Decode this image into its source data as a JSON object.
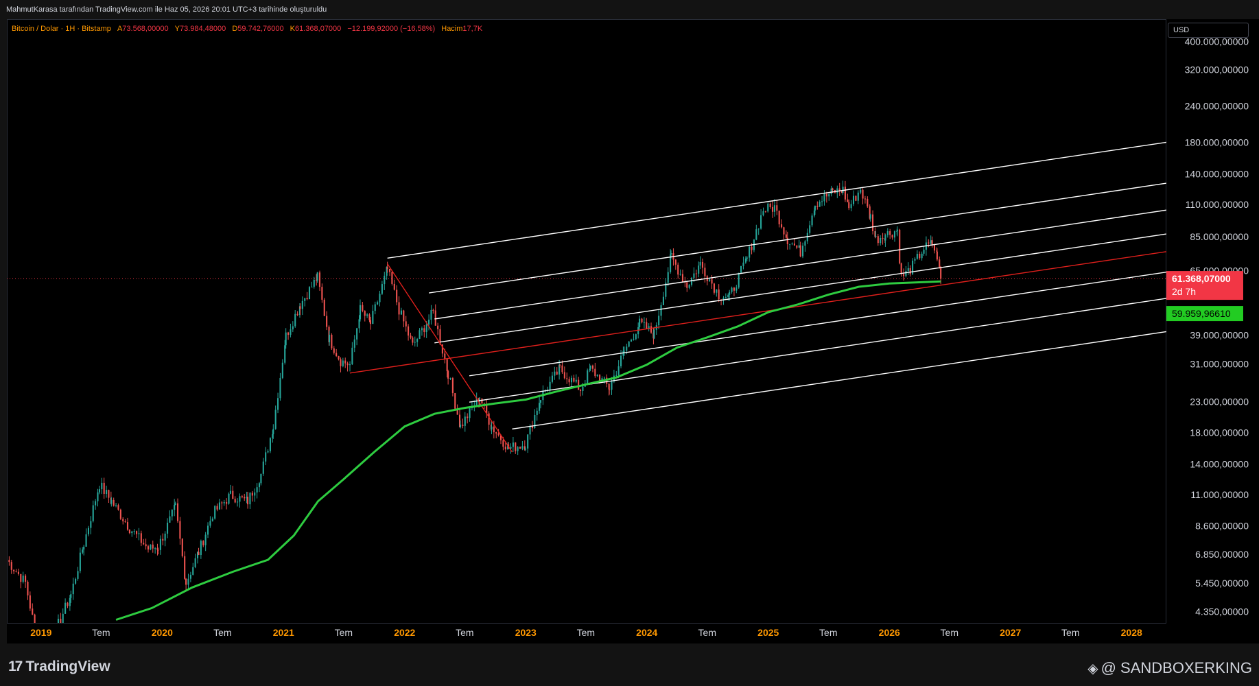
{
  "header": {
    "caption": "MahmutKarasa tarafından TradingView.com ile Haz 05, 2026 20:01 UTC+3 tarihinde oluşturuldu"
  },
  "legend": {
    "symbol": "Bitcoin / Dolar · 1H · Bitstamp",
    "open_label": "A",
    "open_value": "73.568,00000",
    "high_label": "Y",
    "high_value": "73.984,48000",
    "low_label": "D",
    "low_value": "59.742,76000",
    "close_label": "K",
    "close_value": "61.368,07000",
    "change_value": "−12.199,92000 (−16,58%)",
    "volume_label": "Hacim",
    "volume_value": "17,7K"
  },
  "currency": "USD",
  "price_tags": {
    "last_price": "61.368,07000",
    "countdown": "2d 7h",
    "ma_value": "59.959,96610"
  },
  "footer": {
    "logo_text": "TradingView",
    "watermark": "@ SANDBOXERKING"
  },
  "colors": {
    "background": "#000000",
    "up": "#26a69a",
    "down": "#ef5350",
    "ma": "#2ecc40",
    "channel": "#ffffff",
    "median": "#e0201c",
    "axis_text": "#d1d4dc",
    "year_text": "#ff9800"
  },
  "chart_data": {
    "type": "candlestick",
    "symbol": "Bitcoin / Dolar",
    "scale": "log",
    "y_ticks": [
      "400.000,00000",
      "320.000,00000",
      "240.000,00000",
      "180.000,00000",
      "140.000,00000",
      "110.000,00000",
      "85.000,00000",
      "65.000,00000",
      "39.000,00000",
      "31.000,00000",
      "23.000,00000",
      "18.000,00000",
      "14.000,00000",
      "11.000,00000",
      "8.600,00000",
      "6.850,00000",
      "5.450,00000",
      "4.350,00000"
    ],
    "y_tick_values": [
      400000,
      320000,
      240000,
      180000,
      140000,
      110000,
      85000,
      65000,
      39000,
      31000,
      23000,
      18000,
      14000,
      11000,
      8600,
      6850,
      5450,
      4350
    ],
    "x_ticks": [
      {
        "label": "2019",
        "date": "2019-01-01",
        "year": true
      },
      {
        "label": "Tem",
        "date": "2019-07-01",
        "year": false
      },
      {
        "label": "2020",
        "date": "2020-01-01",
        "year": true
      },
      {
        "label": "Tem",
        "date": "2020-07-01",
        "year": false
      },
      {
        "label": "2021",
        "date": "2021-01-01",
        "year": true
      },
      {
        "label": "Tem",
        "date": "2021-07-01",
        "year": false
      },
      {
        "label": "2022",
        "date": "2022-01-01",
        "year": true
      },
      {
        "label": "Tem",
        "date": "2022-07-01",
        "year": false
      },
      {
        "label": "2023",
        "date": "2023-01-01",
        "year": true
      },
      {
        "label": "Tem",
        "date": "2023-07-01",
        "year": false
      },
      {
        "label": "2024",
        "date": "2024-01-01",
        "year": true
      },
      {
        "label": "Tem",
        "date": "2024-07-01",
        "year": false
      },
      {
        "label": "2025",
        "date": "2025-01-01",
        "year": true
      },
      {
        "label": "Tem",
        "date": "2025-07-01",
        "year": false
      },
      {
        "label": "2026",
        "date": "2026-01-01",
        "year": true
      },
      {
        "label": "Tem",
        "date": "2026-07-01",
        "year": false
      },
      {
        "label": "2027",
        "date": "2027-01-01",
        "year": true
      },
      {
        "label": "Tem",
        "date": "2027-07-01",
        "year": false
      },
      {
        "label": "2028",
        "date": "2028-01-01",
        "year": true
      }
    ],
    "x_range": [
      "2018-09-20",
      "2028-04-15"
    ],
    "y_range": [
      4000,
      480000
    ],
    "close_series": [
      {
        "date": "2018-09-20",
        "close": 6600
      },
      {
        "date": "2018-11-15",
        "close": 5500
      },
      {
        "date": "2018-12-15",
        "close": 3700
      },
      {
        "date": "2019-02-15",
        "close": 3800
      },
      {
        "date": "2019-04-01",
        "close": 5000
      },
      {
        "date": "2019-05-10",
        "close": 7500
      },
      {
        "date": "2019-06-26",
        "close": 12000
      },
      {
        "date": "2019-08-01",
        "close": 10500
      },
      {
        "date": "2019-09-25",
        "close": 8500
      },
      {
        "date": "2019-11-20",
        "close": 7200
      },
      {
        "date": "2019-12-20",
        "close": 7300
      },
      {
        "date": "2020-02-10",
        "close": 10000
      },
      {
        "date": "2020-03-13",
        "close": 5500
      },
      {
        "date": "2020-04-20",
        "close": 7000
      },
      {
        "date": "2020-06-01",
        "close": 9500
      },
      {
        "date": "2020-07-25",
        "close": 11000
      },
      {
        "date": "2020-09-15",
        "close": 10500
      },
      {
        "date": "2020-10-25",
        "close": 13000
      },
      {
        "date": "2020-12-01",
        "close": 19000
      },
      {
        "date": "2021-01-08",
        "close": 39000
      },
      {
        "date": "2021-02-20",
        "close": 50000
      },
      {
        "date": "2021-04-13",
        "close": 62000
      },
      {
        "date": "2021-05-19",
        "close": 38000
      },
      {
        "date": "2021-06-22",
        "close": 32000
      },
      {
        "date": "2021-07-20",
        "close": 31000
      },
      {
        "date": "2021-08-20",
        "close": 48000
      },
      {
        "date": "2021-09-20",
        "close": 43000
      },
      {
        "date": "2021-11-10",
        "close": 66000
      },
      {
        "date": "2021-12-15",
        "close": 48000
      },
      {
        "date": "2022-01-25",
        "close": 36000
      },
      {
        "date": "2022-03-28",
        "close": 47000
      },
      {
        "date": "2022-05-12",
        "close": 29000
      },
      {
        "date": "2022-06-18",
        "close": 19000
      },
      {
        "date": "2022-08-15",
        "close": 24000
      },
      {
        "date": "2022-09-20",
        "close": 19000
      },
      {
        "date": "2022-11-10",
        "close": 16000
      },
      {
        "date": "2022-12-31",
        "close": 16500
      },
      {
        "date": "2023-02-15",
        "close": 24000
      },
      {
        "date": "2023-04-14",
        "close": 30000
      },
      {
        "date": "2023-06-15",
        "close": 25500
      },
      {
        "date": "2023-07-15",
        "close": 30000
      },
      {
        "date": "2023-09-10",
        "close": 25800
      },
      {
        "date": "2023-10-25",
        "close": 34500
      },
      {
        "date": "2023-12-10",
        "close": 43000
      },
      {
        "date": "2024-01-23",
        "close": 39500
      },
      {
        "date": "2024-03-14",
        "close": 73000
      },
      {
        "date": "2024-05-01",
        "close": 58000
      },
      {
        "date": "2024-06-10",
        "close": 69000
      },
      {
        "date": "2024-08-05",
        "close": 54000
      },
      {
        "date": "2024-09-06",
        "close": 53000
      },
      {
        "date": "2024-10-29",
        "close": 72000
      },
      {
        "date": "2024-12-17",
        "close": 106000
      },
      {
        "date": "2025-01-20",
        "close": 108000
      },
      {
        "date": "2025-02-28",
        "close": 84000
      },
      {
        "date": "2025-04-08",
        "close": 76000
      },
      {
        "date": "2025-05-22",
        "close": 111000
      },
      {
        "date": "2025-07-14",
        "close": 122000
      },
      {
        "date": "2025-08-14",
        "close": 124000
      },
      {
        "date": "2025-09-01",
        "close": 108000
      },
      {
        "date": "2025-10-06",
        "close": 125000
      },
      {
        "date": "2025-11-05",
        "close": 100000
      },
      {
        "date": "2025-11-21",
        "close": 84000
      },
      {
        "date": "2025-12-20",
        "close": 87000
      },
      {
        "date": "2026-01-25",
        "close": 90000
      },
      {
        "date": "2026-02-06",
        "close": 62000
      },
      {
        "date": "2026-03-05",
        "close": 66000
      },
      {
        "date": "2026-04-15",
        "close": 78000
      },
      {
        "date": "2026-05-10",
        "close": 81000
      },
      {
        "date": "2026-05-25",
        "close": 73568
      },
      {
        "date": "2026-06-05",
        "close": 61368
      }
    ],
    "moving_average": [
      {
        "date": "2019-08-15",
        "value": 4100
      },
      {
        "date": "2019-12-01",
        "value": 4500
      },
      {
        "date": "2020-04-01",
        "value": 5300
      },
      {
        "date": "2020-08-01",
        "value": 6000
      },
      {
        "date": "2020-11-15",
        "value": 6600
      },
      {
        "date": "2021-02-01",
        "value": 8000
      },
      {
        "date": "2021-04-15",
        "value": 10500
      },
      {
        "date": "2021-07-01",
        "value": 12500
      },
      {
        "date": "2021-10-01",
        "value": 15500
      },
      {
        "date": "2022-01-01",
        "value": 19000
      },
      {
        "date": "2022-04-01",
        "value": 21000
      },
      {
        "date": "2022-07-01",
        "value": 22000
      },
      {
        "date": "2022-10-01",
        "value": 22800
      },
      {
        "date": "2023-01-01",
        "value": 23500
      },
      {
        "date": "2023-04-01",
        "value": 25000
      },
      {
        "date": "2023-07-01",
        "value": 26500
      },
      {
        "date": "2023-10-01",
        "value": 28000
      },
      {
        "date": "2024-01-01",
        "value": 31000
      },
      {
        "date": "2024-04-01",
        "value": 35500
      },
      {
        "date": "2024-07-01",
        "value": 38500
      },
      {
        "date": "2024-10-01",
        "value": 42000
      },
      {
        "date": "2025-01-01",
        "value": 47000
      },
      {
        "date": "2025-04-01",
        "value": 50000
      },
      {
        "date": "2025-07-01",
        "value": 54000
      },
      {
        "date": "2025-10-01",
        "value": 57500
      },
      {
        "date": "2026-01-01",
        "value": 59000
      },
      {
        "date": "2026-06-05",
        "value": 59960
      }
    ],
    "last_price": 61368.07,
    "ma_last": 59959.9661,
    "channel": {
      "anchor_high": {
        "date": "2021-11-10",
        "value": 69000
      },
      "anchor_low": {
        "date": "2022-11-21",
        "value": 15500
      },
      "median_start": {
        "date": "2021-07-20",
        "value": 29000
      },
      "median_end": {
        "date": "2028-04-15",
        "value": 76000
      },
      "line_offsets": [
        2.38,
        1.72,
        1.39,
        1.15,
        0.85,
        0.69,
        0.53
      ],
      "line_starts": [
        "2021-11-10",
        "2022-03-15",
        "2022-04-01",
        "2022-04-01",
        "2022-07-15",
        "2022-07-15",
        "2022-11-21"
      ]
    },
    "xlabel": "",
    "ylabel": ""
  }
}
